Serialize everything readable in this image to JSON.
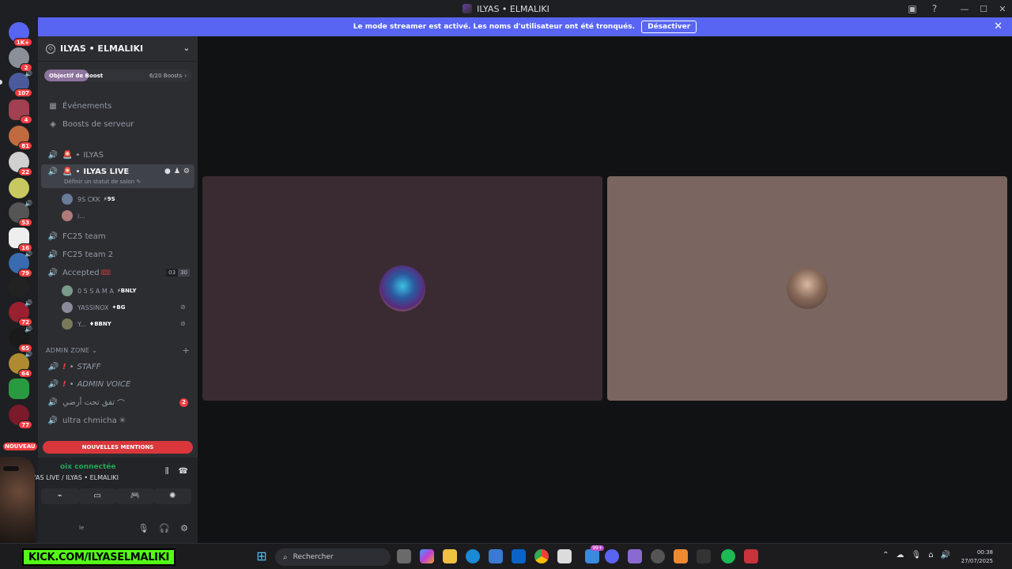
{
  "window": {
    "title": "ILYAS • ELMALIKI"
  },
  "banner": {
    "text": "Le mode streamer est activé. Les noms d'utilisateur ont été tronqués.",
    "button": "Désactiver"
  },
  "servers": [
    {
      "badge": "1K+"
    },
    {
      "badge": "2"
    },
    {
      "badge": "107"
    },
    {
      "badge": "4"
    },
    {
      "badge": "81"
    },
    {
      "badge": "22"
    },
    {
      "badge": ""
    },
    {
      "badge": "53"
    },
    {
      "badge": "16"
    },
    {
      "badge": "79"
    },
    {
      "badge": ""
    },
    {
      "badge": "72"
    },
    {
      "badge": "65"
    },
    {
      "badge": "64"
    },
    {
      "badge": ""
    },
    {
      "badge": "77"
    }
  ],
  "server_new_label": "NOUVEAU",
  "guild": {
    "name": "ILYAS • ELMALIKI",
    "boost_label": "Objectif de Boost",
    "boost_count": "6/20 Boosts",
    "boost_progress": 0.3
  },
  "nav": {
    "events": "Événements",
    "boosts": "Boosts de serveur"
  },
  "channels": {
    "ilyas": "ILYAS",
    "ilyas_live": "ILYAS LIVE",
    "ilyas_live_status": "Définir un statut de salon",
    "members_live": [
      {
        "name": "9S CKK",
        "tag": "9S"
      },
      {
        "name": "i...",
        "tag": ""
      }
    ],
    "fc25": "FC25 team",
    "fc25_2": "FC25 team 2",
    "accepted": "Accepted",
    "accepted_count": "03",
    "accepted_limit": "30",
    "members_accepted": [
      {
        "name": "0 5 S A M A",
        "tag": "BNLY"
      },
      {
        "name": "YASSINOX",
        "tag": "BG"
      },
      {
        "name": "Y...",
        "tag": "BBNY"
      }
    ],
    "admin_category": "ADMIN ZONE",
    "staff": "STAFF",
    "admin_voice": "ADMIN VOICE",
    "arabic": "تفق تحت أرضي",
    "arabic_badge": "2",
    "ultra": "ultra chmicha"
  },
  "mentions": "NOUVELLES MENTIONS",
  "voice": {
    "status": "oix connectée",
    "channel": "ILYAS LIVE / ILYAS • ELMALIKI",
    "user_status": "le"
  },
  "kick": {
    "text": "KICK.COM/ILYASELMALIKI"
  },
  "taskbar": {
    "search": "Rechercher",
    "badge_99": "99+",
    "time": "00:38",
    "date": "27/07/2025"
  }
}
